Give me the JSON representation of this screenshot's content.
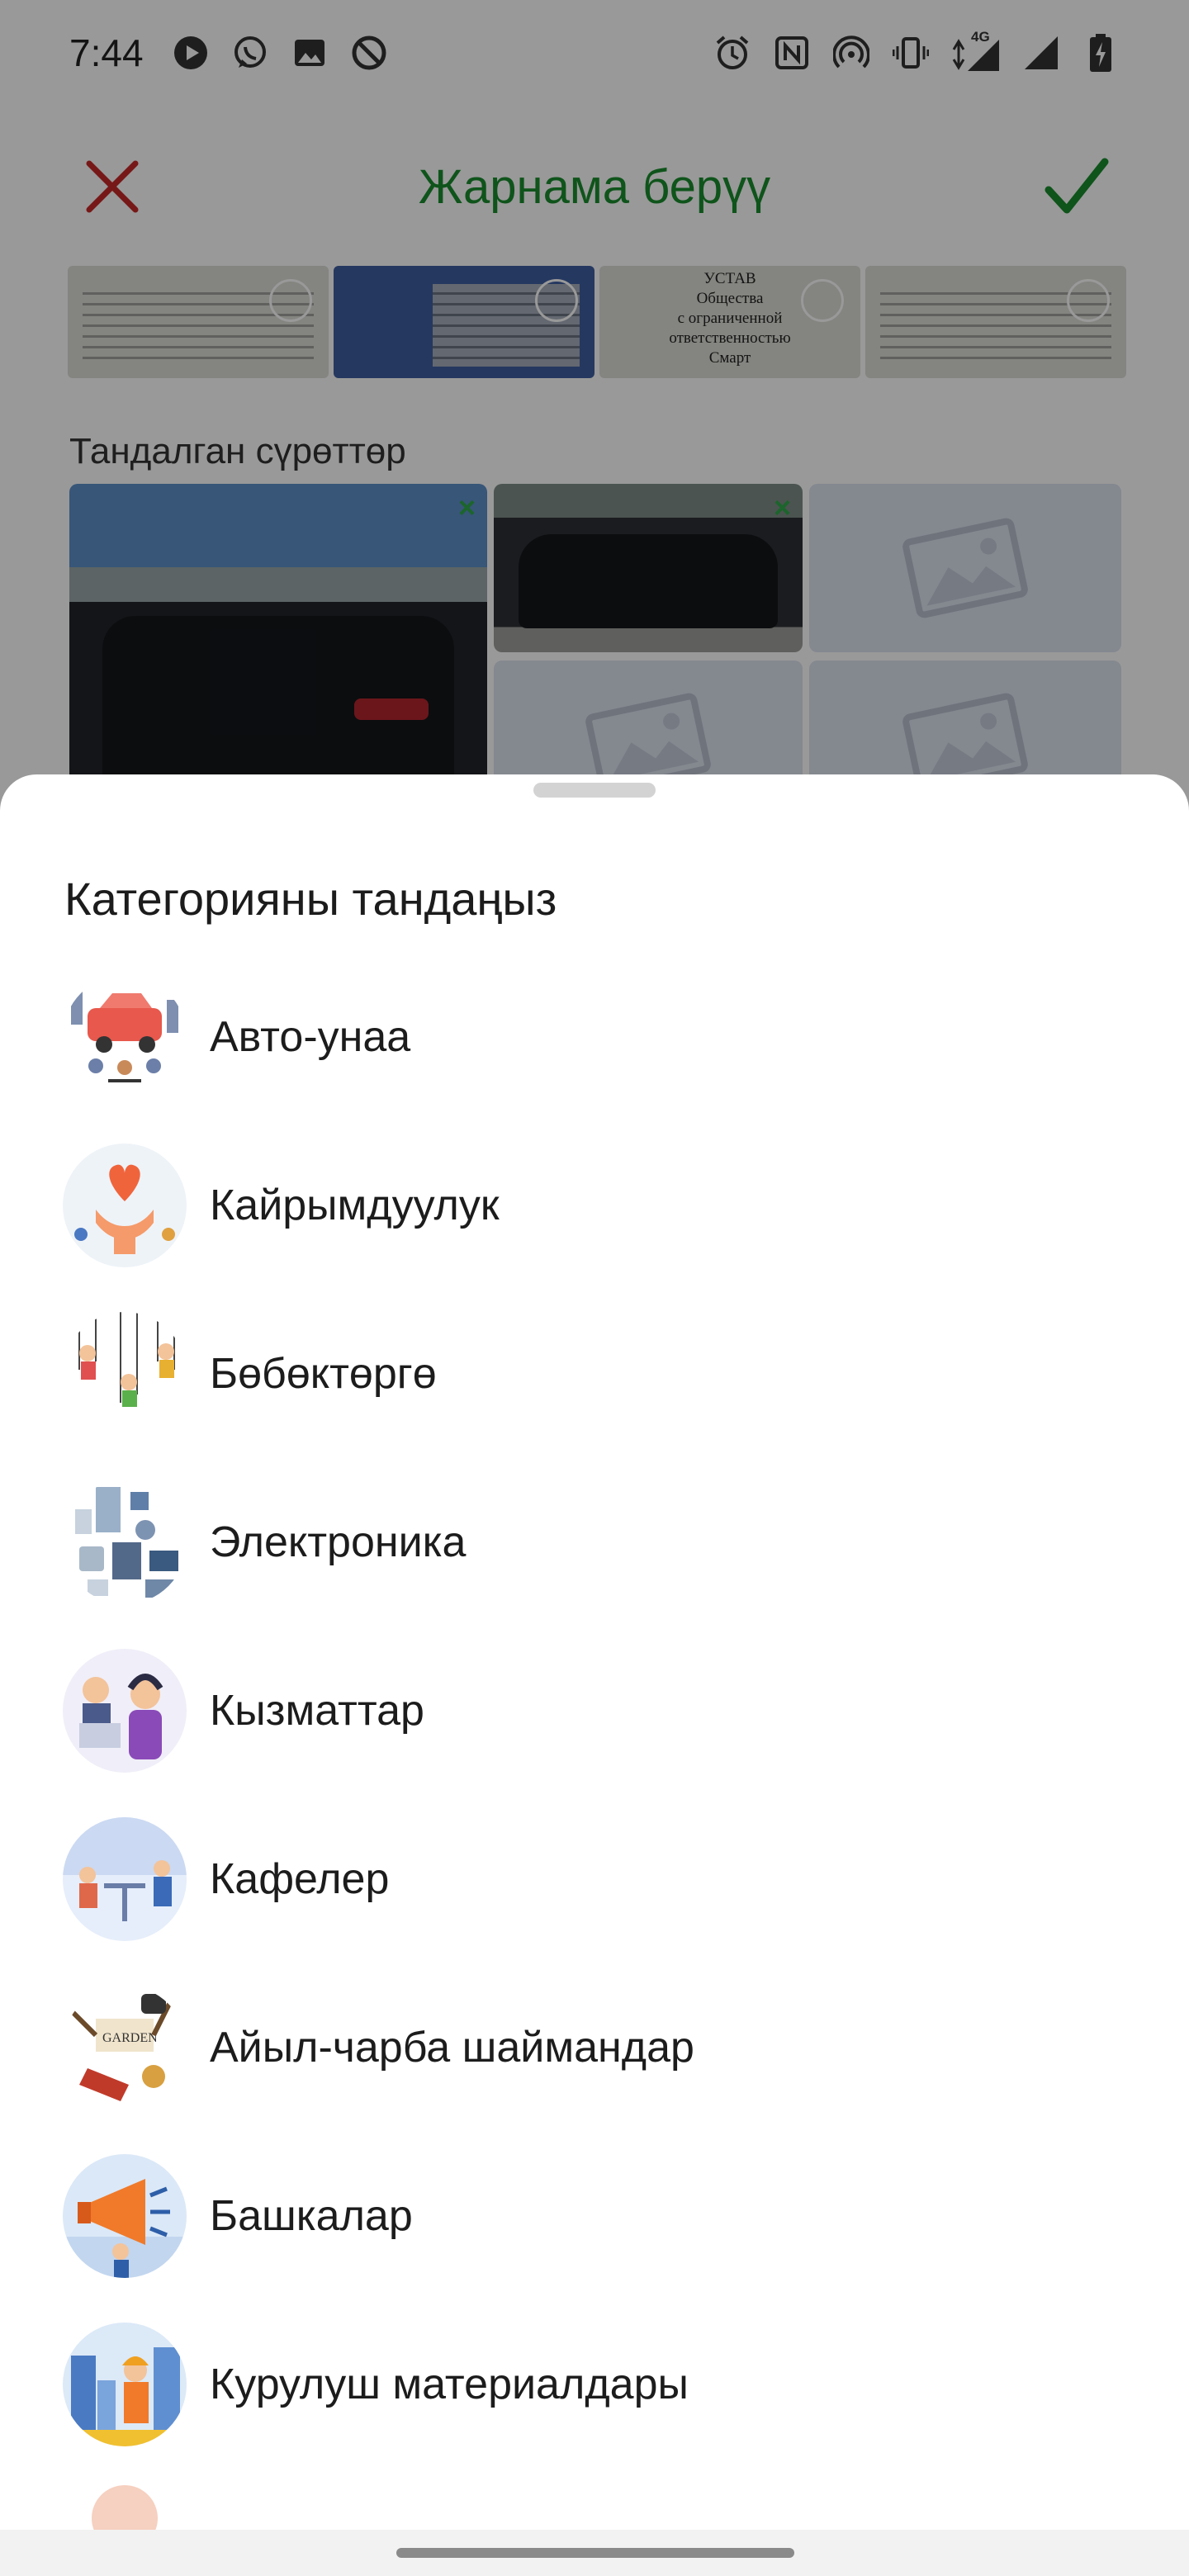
{
  "status_bar": {
    "time": "7:44",
    "left_icons": [
      "play-icon",
      "whatsapp-icon",
      "gallery-icon",
      "do-not-disturb-icon"
    ],
    "right_icons": [
      "alarm-icon",
      "nfc-icon",
      "hotspot-icon",
      "vibrate-icon",
      "4g-signal-icon",
      "signal-icon",
      "battery-icon"
    ],
    "network_label": "4G"
  },
  "toolbar": {
    "title": "Жарнама берүү",
    "close_icon": "close-icon",
    "done_icon": "check-icon",
    "accent_color": "#1a8c2d",
    "close_color": "#c62828"
  },
  "gallery": {
    "thumb_text": "УСТАВ\nОбщества\nс ограниченной\nответственностью\nСмарт"
  },
  "selected": {
    "label": "Тандалган сүрөттөр",
    "remove_mark": "×"
  },
  "sheet": {
    "title": "Категорияны тандаңыз",
    "items": [
      {
        "label": "Авто-унаа",
        "icon": "car-service-icon"
      },
      {
        "label": "Кайрымдуулук",
        "icon": "charity-hands-heart-icon"
      },
      {
        "label": "Бөбөктөргө",
        "icon": "kids-swings-icon"
      },
      {
        "label": "Электроника",
        "icon": "electronics-icon"
      },
      {
        "label": "Кызматтар",
        "icon": "services-support-icon"
      },
      {
        "label": "Кафелер",
        "icon": "cafe-icon"
      },
      {
        "label": "Айыл-чарба шаймандар",
        "icon": "garden-tools-icon"
      },
      {
        "label": "Башкалар",
        "icon": "megaphone-icon"
      },
      {
        "label": "Курулуш материалдары",
        "icon": "construction-worker-icon"
      }
    ]
  }
}
